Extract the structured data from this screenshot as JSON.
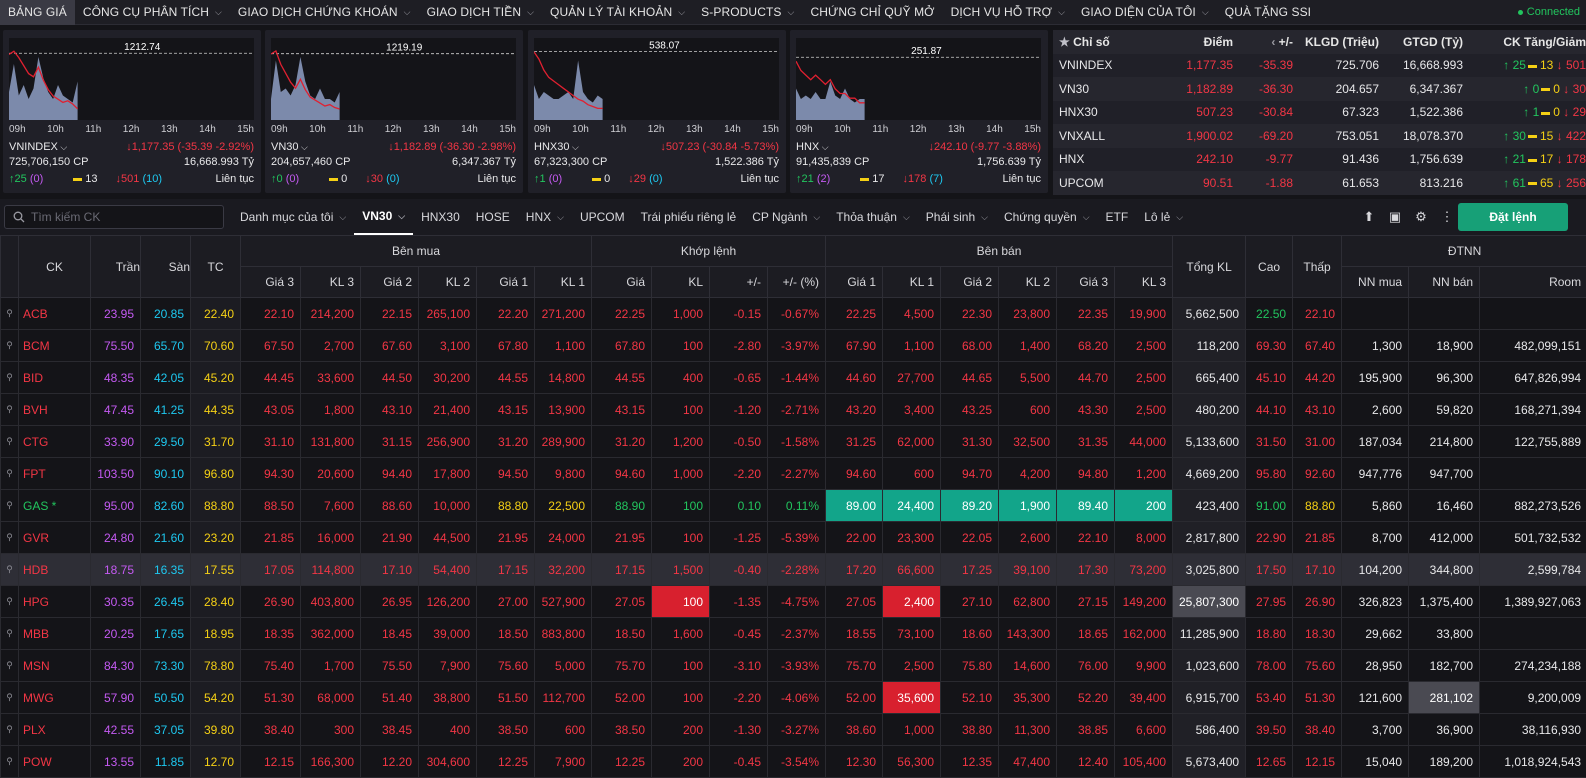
{
  "nav": {
    "items": [
      "BẢNG GIÁ",
      "CÔNG CỤ PHÂN TÍCH",
      "GIAO DỊCH CHỨNG KHOÁN",
      "GIAO DỊCH TIỀN",
      "QUẢN LÝ TÀI KHOẢN",
      "S-PRODUCTS",
      "CHỨNG CHỈ QUỸ MỞ",
      "DỊCH VỤ HỖ TRỢ",
      "GIAO DIỆN CỦA TÔI",
      "QUÀ TẶNG SSI"
    ],
    "connection": "Connected"
  },
  "charts": [
    {
      "name": "VNINDEX",
      "ref": "1212.74",
      "change": "1,177.35 (-35.39 -2.92%)",
      "volume": "725,706,150 CP",
      "value": "16,668.993 Tỷ",
      "up": "25",
      "up_ceil": "(0)",
      "flat": "13",
      "down": "501",
      "down_floor": "(10)",
      "status": "Liên tục",
      "chart_data": {
        "type": "area",
        "x": [
          "09h",
          "10h",
          "11h",
          "12h",
          "13h",
          "14h",
          "15h"
        ],
        "ref": 1212.74,
        "price": [
          1212,
          1214,
          1210,
          1205,
          1200,
          1198,
          1204,
          1196,
          1190,
          1186,
          1184,
          1182,
          1183,
          1181,
          1178
        ],
        "volume": [
          0.4,
          0.8,
          0.35,
          0.5,
          0.3,
          0.45,
          0.9,
          0.6,
          0.4,
          0.3,
          0.5,
          0.35,
          0.3,
          0.25,
          0.55
        ]
      }
    },
    {
      "name": "VN30",
      "ref": "1219.19",
      "change": "1,182.89 (-36.30 -2.98%)",
      "volume": "204,657,460 CP",
      "value": "6,347.367 Tỷ",
      "up": "0",
      "up_ceil": "(0)",
      "flat": "0",
      "down": "30",
      "down_floor": "(0)",
      "status": "Liên tục",
      "chart_data": {
        "type": "area",
        "x": [
          "09h",
          "10h",
          "11h",
          "12h",
          "13h",
          "14h",
          "15h"
        ],
        "ref": 1219.19,
        "price": [
          1219,
          1221,
          1212,
          1206,
          1200,
          1196,
          1202,
          1195,
          1190,
          1188,
          1186,
          1184,
          1185,
          1183,
          1182
        ],
        "volume": [
          0.3,
          0.85,
          0.4,
          0.45,
          0.35,
          0.5,
          0.9,
          0.55,
          0.35,
          0.3,
          0.45,
          0.3,
          0.3,
          0.25,
          0.4
        ]
      }
    },
    {
      "name": "HNX30",
      "ref": "538.07",
      "change": "507.23 (-30.84 -5.73%)",
      "volume": "67,323,300 CP",
      "value": "1,522.386 Tỷ",
      "up": "1",
      "up_ceil": "(0)",
      "flat": "0",
      "down": "29",
      "down_floor": "(0)",
      "status": "Liên tục",
      "chart_data": {
        "type": "area",
        "x": [
          "09h",
          "10h",
          "11h",
          "12h",
          "13h",
          "14h",
          "15h"
        ],
        "ref": 538.07,
        "price": [
          538,
          534,
          528,
          524,
          522,
          520,
          518,
          516,
          514,
          512,
          511,
          509,
          508,
          507,
          507
        ],
        "volume": [
          0.5,
          0.3,
          0.4,
          0.35,
          0.3,
          0.3,
          0.35,
          0.4,
          0.3,
          0.85,
          0.4,
          0.3,
          0.25,
          0.35,
          0.3
        ]
      }
    },
    {
      "name": "HNX",
      "ref": "251.87",
      "change": "242.10 (-9.77 -3.88%)",
      "volume": "91,435,839 CP",
      "value": "1,756.639 Tỷ",
      "up": "21",
      "up_ceil": "(2)",
      "flat": "17",
      "down": "178",
      "down_floor": "(7)",
      "status": "Liên tục",
      "chart_data": {
        "type": "area",
        "x": [
          "09h",
          "10h",
          "11h",
          "12h",
          "13h",
          "14h",
          "15h"
        ],
        "ref": 251.87,
        "price": [
          251,
          249,
          248,
          247,
          248,
          247,
          246,
          247,
          245,
          244,
          244,
          243,
          243,
          242,
          242
        ],
        "volume": [
          0.45,
          0.3,
          0.35,
          0.3,
          0.4,
          0.3,
          0.3,
          0.55,
          0.35,
          0.3,
          0.45,
          0.3,
          0.25,
          0.3,
          0.3
        ]
      }
    }
  ],
  "index_table": {
    "headers": [
      "Chỉ số",
      "Điểm",
      "+/-",
      "KLGD (Triệu)",
      "GTGD (Tỷ)",
      "CK Tăng/Giảm"
    ],
    "rows": [
      {
        "name": "VNINDEX",
        "point": "1,177.35",
        "chg": "-35.39",
        "vol": "725.706",
        "val": "16,668.993",
        "up": "25",
        "flat": "13",
        "down": "501"
      },
      {
        "name": "VN30",
        "point": "1,182.89",
        "chg": "-36.30",
        "vol": "204.657",
        "val": "6,347.367",
        "up": "0",
        "flat": "0",
        "down": "30"
      },
      {
        "name": "HNX30",
        "point": "507.23",
        "chg": "-30.84",
        "vol": "67.323",
        "val": "1,522.386",
        "up": "1",
        "flat": "0",
        "down": "29"
      },
      {
        "name": "VNXALL",
        "point": "1,900.02",
        "chg": "-69.20",
        "vol": "753.051",
        "val": "18,078.370",
        "up": "30",
        "flat": "15",
        "down": "422"
      },
      {
        "name": "HNX",
        "point": "242.10",
        "chg": "-9.77",
        "vol": "91.436",
        "val": "1,756.639",
        "up": "21",
        "flat": "17",
        "down": "178"
      },
      {
        "name": "UPCOM",
        "point": "90.51",
        "chg": "-1.88",
        "vol": "61.653",
        "val": "813.216",
        "up": "61",
        "flat": "65",
        "down": "256"
      }
    ]
  },
  "toolbar": {
    "search_placeholder": "Tìm kiếm CK",
    "tabs": [
      "Danh mục của tôi",
      "VN30",
      "HNX30",
      "HOSE",
      "HNX",
      "UPCOM",
      "Trái phiếu riêng lẻ",
      "CP Ngành",
      "Thỏa thuận",
      "Phái sinh",
      "Chứng quyền",
      "ETF",
      "Lô lẻ"
    ],
    "order_button": "Đặt lệnh"
  },
  "board": {
    "groups": [
      "Bên mua",
      "Khớp lệnh",
      "Bên bán",
      "ĐTNN"
    ],
    "fixed_headers": [
      "CK",
      "Trần",
      "Sàn",
      "TC",
      "Tổng KL",
      "Cao",
      "Thấp"
    ],
    "sub_headers": [
      "Giá 3",
      "KL 3",
      "Giá 2",
      "KL 2",
      "Giá 1",
      "KL 1",
      "Giá",
      "KL",
      "+/-",
      "+/- (%)",
      "Giá 1",
      "KL 1",
      "Giá 2",
      "KL 2",
      "Giá 3",
      "KL 3",
      "NN mua",
      "NN bán",
      "Room"
    ],
    "colors": {
      "red": "#f23645",
      "green": "#22c55e",
      "purple": "#c45af2",
      "cyan": "#1ec8f0",
      "yellow": "#f5d015",
      "teal": "#12a58a"
    },
    "rows": [
      {
        "sym": "ACB",
        "ce": "23.95",
        "fl": "20.85",
        "ref": "22.40",
        "b3": "22.10",
        "bv3": "214,200",
        "b2": "22.15",
        "bv2": "265,100",
        "b1": "22.20",
        "bv1": "271,200",
        "p": "22.25",
        "v": "1,000",
        "d": "-0.15",
        "dp": "-0.67%",
        "s1": "22.25",
        "sv1": "4,500",
        "s2": "22.30",
        "sv2": "23,800",
        "s3": "22.35",
        "sv3": "19,900",
        "tot": "5,662,500",
        "hi": "22.50",
        "lo": "22.10",
        "nb": "",
        "ns": "",
        "room": ""
      },
      {
        "sym": "BCM",
        "ce": "75.50",
        "fl": "65.70",
        "ref": "70.60",
        "b3": "67.50",
        "bv3": "2,700",
        "b2": "67.60",
        "bv2": "3,100",
        "b1": "67.80",
        "bv1": "1,100",
        "p": "67.80",
        "v": "100",
        "d": "-2.80",
        "dp": "-3.97%",
        "s1": "67.90",
        "sv1": "1,100",
        "s2": "68.00",
        "sv2": "1,400",
        "s3": "68.20",
        "sv3": "2,500",
        "tot": "118,200",
        "hi": "69.30",
        "lo": "67.40",
        "nb": "1,300",
        "ns": "18,900",
        "room": "482,099,151"
      },
      {
        "sym": "BID",
        "ce": "48.35",
        "fl": "42.05",
        "ref": "45.20",
        "b3": "44.45",
        "bv3": "33,600",
        "b2": "44.50",
        "bv2": "30,200",
        "b1": "44.55",
        "bv1": "14,800",
        "p": "44.55",
        "v": "400",
        "d": "-0.65",
        "dp": "-1.44%",
        "s1": "44.60",
        "sv1": "27,700",
        "s2": "44.65",
        "sv2": "5,500",
        "s3": "44.70",
        "sv3": "2,500",
        "tot": "665,400",
        "hi": "45.10",
        "lo": "44.20",
        "nb": "195,900",
        "ns": "96,300",
        "room": "647,826,994"
      },
      {
        "sym": "BVH",
        "ce": "47.45",
        "fl": "41.25",
        "ref": "44.35",
        "b3": "43.05",
        "bv3": "1,800",
        "b2": "43.10",
        "bv2": "21,400",
        "b1": "43.15",
        "bv1": "13,900",
        "p": "43.15",
        "v": "100",
        "d": "-1.20",
        "dp": "-2.71%",
        "s1": "43.20",
        "sv1": "3,400",
        "s2": "43.25",
        "sv2": "600",
        "s3": "43.30",
        "sv3": "2,500",
        "tot": "480,200",
        "hi": "44.10",
        "lo": "43.10",
        "nb": "2,600",
        "ns": "59,820",
        "room": "168,271,394"
      },
      {
        "sym": "CTG",
        "ce": "33.90",
        "fl": "29.50",
        "ref": "31.70",
        "b3": "31.10",
        "bv3": "131,800",
        "b2": "31.15",
        "bv2": "256,900",
        "b1": "31.20",
        "bv1": "289,900",
        "p": "31.20",
        "v": "1,200",
        "d": "-0.50",
        "dp": "-1.58%",
        "s1": "31.25",
        "sv1": "62,000",
        "s2": "31.30",
        "sv2": "32,500",
        "s3": "31.35",
        "sv3": "44,000",
        "tot": "5,133,600",
        "hi": "31.50",
        "lo": "31.00",
        "nb": "187,034",
        "ns": "214,800",
        "room": "122,755,889"
      },
      {
        "sym": "FPT",
        "ce": "103.50",
        "fl": "90.10",
        "ref": "96.80",
        "b3": "94.30",
        "bv3": "20,600",
        "b2": "94.40",
        "bv2": "17,800",
        "b1": "94.50",
        "bv1": "9,800",
        "p": "94.60",
        "v": "1,000",
        "d": "-2.20",
        "dp": "-2.27%",
        "s1": "94.60",
        "sv1": "600",
        "s2": "94.70",
        "sv2": "4,200",
        "s3": "94.80",
        "sv3": "1,200",
        "tot": "4,669,200",
        "hi": "95.80",
        "lo": "92.60",
        "nb": "947,776",
        "ns": "947,700",
        "room": ""
      },
      {
        "sym": "GAS *",
        "ce": "95.00",
        "fl": "82.60",
        "ref": "88.80",
        "b3": "88.50",
        "bv3": "7,600",
        "b2": "88.60",
        "bv2": "10,000",
        "b1": "88.80",
        "bv1": "22,500",
        "p": "88.90",
        "v": "100",
        "d": "0.10",
        "dp": "0.11%",
        "s1": "89.00",
        "sv1": "24,400",
        "s2": "89.20",
        "sv2": "1,900",
        "s3": "89.40",
        "sv3": "200",
        "tot": "423,400",
        "hi": "91.00",
        "lo": "88.80",
        "nb": "5,860",
        "ns": "16,460",
        "room": "882,273,526"
      },
      {
        "sym": "GVR",
        "ce": "24.80",
        "fl": "21.60",
        "ref": "23.20",
        "b3": "21.85",
        "bv3": "16,000",
        "b2": "21.90",
        "bv2": "44,500",
        "b1": "21.95",
        "bv1": "24,000",
        "p": "21.95",
        "v": "100",
        "d": "-1.25",
        "dp": "-5.39%",
        "s1": "22.00",
        "sv1": "23,300",
        "s2": "22.05",
        "sv2": "2,600",
        "s3": "22.10",
        "sv3": "8,000",
        "tot": "2,817,800",
        "hi": "22.90",
        "lo": "21.85",
        "nb": "8,700",
        "ns": "412,000",
        "room": "501,732,532"
      },
      {
        "sym": "HDB",
        "ce": "18.75",
        "fl": "16.35",
        "ref": "17.55",
        "b3": "17.05",
        "bv3": "114,800",
        "b2": "17.10",
        "bv2": "54,400",
        "b1": "17.15",
        "bv1": "32,200",
        "p": "17.15",
        "v": "1,500",
        "d": "-0.40",
        "dp": "-2.28%",
        "s1": "17.20",
        "sv1": "66,600",
        "s2": "17.25",
        "sv2": "39,100",
        "s3": "17.30",
        "sv3": "73,200",
        "tot": "3,025,800",
        "hi": "17.50",
        "lo": "17.10",
        "nb": "104,200",
        "ns": "344,800",
        "room": "2,599,784"
      },
      {
        "sym": "HPG",
        "ce": "30.35",
        "fl": "26.45",
        "ref": "28.40",
        "b3": "26.90",
        "bv3": "403,800",
        "b2": "26.95",
        "bv2": "126,200",
        "b1": "27.00",
        "bv1": "527,900",
        "p": "27.05",
        "v": "100",
        "d": "-1.35",
        "dp": "-4.75%",
        "s1": "27.05",
        "sv1": "2,400",
        "s2": "27.10",
        "sv2": "62,800",
        "s3": "27.15",
        "sv3": "149,200",
        "tot": "25,807,300",
        "hi": "27.95",
        "lo": "26.90",
        "nb": "326,823",
        "ns": "1,375,400",
        "room": "1,389,927,063"
      },
      {
        "sym": "MBB",
        "ce": "20.25",
        "fl": "17.65",
        "ref": "18.95",
        "b3": "18.35",
        "bv3": "362,000",
        "b2": "18.45",
        "bv2": "39,000",
        "b1": "18.50",
        "bv1": "883,800",
        "p": "18.50",
        "v": "1,600",
        "d": "-0.45",
        "dp": "-2.37%",
        "s1": "18.55",
        "sv1": "73,100",
        "s2": "18.60",
        "sv2": "143,300",
        "s3": "18.65",
        "sv3": "162,000",
        "tot": "11,285,900",
        "hi": "18.80",
        "lo": "18.30",
        "nb": "29,662",
        "ns": "33,800",
        "room": ""
      },
      {
        "sym": "MSN",
        "ce": "84.30",
        "fl": "73.30",
        "ref": "78.80",
        "b3": "75.40",
        "bv3": "1,700",
        "b2": "75.50",
        "bv2": "7,900",
        "b1": "75.60",
        "bv1": "5,000",
        "p": "75.70",
        "v": "100",
        "d": "-3.10",
        "dp": "-3.93%",
        "s1": "75.70",
        "sv1": "2,500",
        "s2": "75.80",
        "sv2": "14,600",
        "s3": "76.00",
        "sv3": "9,900",
        "tot": "1,023,600",
        "hi": "78.00",
        "lo": "75.60",
        "nb": "28,950",
        "ns": "182,700",
        "room": "274,234,188"
      },
      {
        "sym": "MWG",
        "ce": "57.90",
        "fl": "50.50",
        "ref": "54.20",
        "b3": "51.30",
        "bv3": "68,000",
        "b2": "51.40",
        "bv2": "38,800",
        "b1": "51.50",
        "bv1": "112,700",
        "p": "52.00",
        "v": "100",
        "d": "-2.20",
        "dp": "-4.06%",
        "s1": "52.00",
        "sv1": "35,600",
        "s2": "52.10",
        "sv2": "35,300",
        "s3": "52.20",
        "sv3": "39,400",
        "tot": "6,915,700",
        "hi": "53.40",
        "lo": "51.30",
        "nb": "121,600",
        "ns": "281,102",
        "room": "9,200,009"
      },
      {
        "sym": "PLX",
        "ce": "42.55",
        "fl": "37.05",
        "ref": "39.80",
        "b3": "38.40",
        "bv3": "300",
        "b2": "38.45",
        "bv2": "400",
        "b1": "38.50",
        "bv1": "600",
        "p": "38.50",
        "v": "200",
        "d": "-1.30",
        "dp": "-3.27%",
        "s1": "38.60",
        "sv1": "1,000",
        "s2": "38.80",
        "sv2": "11,300",
        "s3": "38.85",
        "sv3": "6,600",
        "tot": "586,400",
        "hi": "39.50",
        "lo": "38.40",
        "nb": "3,700",
        "ns": "36,900",
        "room": "38,116,930"
      },
      {
        "sym": "POW",
        "ce": "13.55",
        "fl": "11.85",
        "ref": "12.70",
        "b3": "12.15",
        "bv3": "166,300",
        "b2": "12.20",
        "bv2": "304,600",
        "b1": "12.25",
        "bv1": "7,900",
        "p": "12.25",
        "v": "200",
        "d": "-0.45",
        "dp": "-3.54%",
        "s1": "12.30",
        "sv1": "56,300",
        "s2": "12.35",
        "sv2": "47,400",
        "s3": "12.40",
        "sv3": "105,400",
        "tot": "5,673,400",
        "hi": "12.65",
        "lo": "12.15",
        "nb": "15,040",
        "ns": "189,200",
        "room": "1,018,924,543"
      }
    ]
  }
}
